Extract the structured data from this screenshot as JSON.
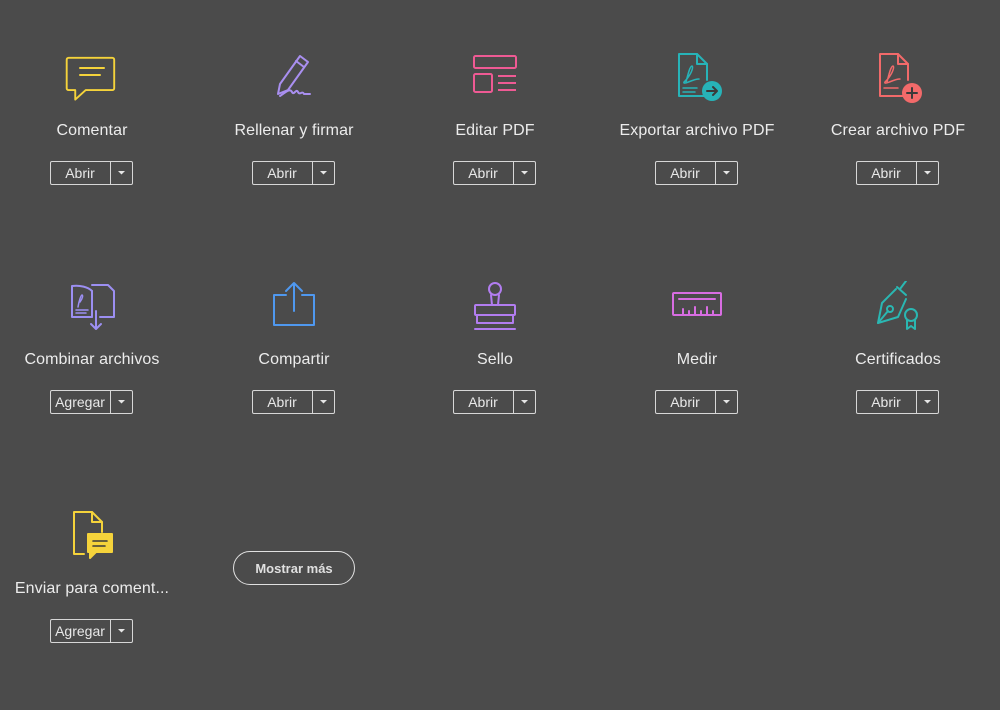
{
  "colors": {
    "background": "#4b4b4b",
    "comment": "#f5d33b",
    "fill_sign": "#a98ff0",
    "edit": "#ef5a94",
    "export": "#27b3b8",
    "create": "#f26a6a",
    "combine": "#9c8ff2",
    "share": "#4f98ef",
    "stamp": "#b27df0",
    "measure": "#d86de2",
    "certificates": "#2ab7b2"
  },
  "tools": [
    {
      "label": "Comentar",
      "button": "Abrir",
      "icon": "comment-icon"
    },
    {
      "label": "Rellenar y firmar",
      "button": "Abrir",
      "icon": "fill-sign-icon"
    },
    {
      "label": "Editar PDF",
      "button": "Abrir",
      "icon": "edit-pdf-icon"
    },
    {
      "label": "Exportar archivo PDF",
      "button": "Abrir",
      "icon": "export-pdf-icon"
    },
    {
      "label": "Crear archivo PDF",
      "button": "Abrir",
      "icon": "create-pdf-icon"
    },
    {
      "label": "Combinar archivos",
      "button": "Agregar",
      "icon": "combine-files-icon"
    },
    {
      "label": "Compartir",
      "button": "Abrir",
      "icon": "share-icon"
    },
    {
      "label": "Sello",
      "button": "Abrir",
      "icon": "stamp-icon"
    },
    {
      "label": "Medir",
      "button": "Abrir",
      "icon": "measure-icon"
    },
    {
      "label": "Certificados",
      "button": "Abrir",
      "icon": "certificates-icon"
    },
    {
      "label": "Enviar para coment...",
      "button": "Agregar",
      "icon": "send-for-comments-icon"
    }
  ],
  "show_more_label": "Mostrar más"
}
